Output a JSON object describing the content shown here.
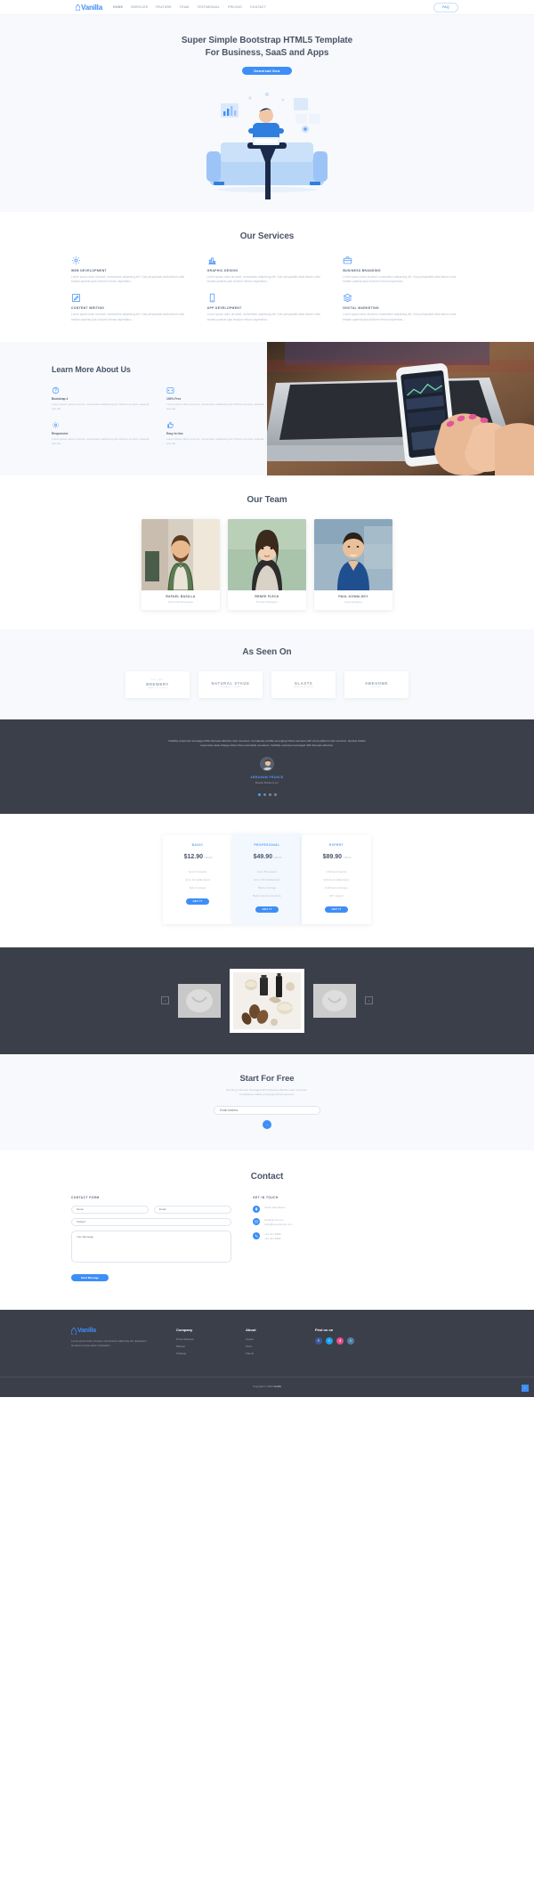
{
  "brand": {
    "name": "Vanilla",
    "icon": "water-drop-icon",
    "accent": "#3e8ef7"
  },
  "nav": {
    "items": [
      "HOME",
      "SERVICES",
      "FEATURE",
      "TEAM",
      "TESTIMONIAL",
      "PRICING",
      "CONTACT"
    ],
    "cta": "FAQ"
  },
  "hero": {
    "title_line1": "Super Simple Bootstrap HTML5 Template",
    "title_line2": "For Business, SaaS and Apps",
    "button": "Download Now",
    "illustration": "man-working-on-laptop-on-sofa-illustration"
  },
  "services": {
    "title": "Our Services",
    "body": "Lorem ipsum dolor sit amet, consectetur adipiscing elit. Cras perspiciatis dicta labore nulla beatae quaerat quia incidunt rebrum asperiatus...",
    "items": [
      {
        "icon": "gear-icon",
        "title": "WEB DEVELOPMENT"
      },
      {
        "icon": "bar-chart-icon",
        "title": "GRAPHIC DESIGN"
      },
      {
        "icon": "briefcase-icon",
        "title": "BUSINESS BRANDING"
      },
      {
        "icon": "pencil-square-icon",
        "title": "CONTENT WRITING"
      },
      {
        "icon": "mobile-phone-icon",
        "title": "APP DEVELOPMENT"
      },
      {
        "icon": "layers-icon",
        "title": "DIGITAL MARKETING"
      }
    ]
  },
  "about": {
    "title": "Learn More About Us",
    "body": "Lorem ipsum dolor sit amet, consectetur adipiscing elit. Dictum tempore quaerat sed diu.",
    "items": [
      {
        "icon": "question-circle-icon",
        "title": "Bootstrap 4"
      },
      {
        "icon": "code-icon",
        "title": "100% Free"
      },
      {
        "icon": "gear-icon",
        "title": "Responsive"
      },
      {
        "icon": "thumbs-up-icon",
        "title": "Easy to Use"
      }
    ],
    "image": "hands-holding-smartphone-over-laptop-photo"
  },
  "team": {
    "title": "Our Team",
    "members": [
      {
        "name": "RAFAEL BASILLA",
        "role": "Front-end Developer",
        "photo": "bearded-man-in-plaid-shirt-photo"
      },
      {
        "name": "RENEE FLECK",
        "role": "Product Designer",
        "photo": "woman-with-long-hair-photo"
      },
      {
        "name": "PAUL KOWALSKY",
        "role": "Lead Designer",
        "photo": "smiling-man-in-blue-shirt-photo"
      }
    ]
  },
  "clients": {
    "title": "As Seen On",
    "logos": [
      {
        "top": "EST. 1987",
        "name": "BREWERY",
        "sub": "CRAFT & STOUT"
      },
      {
        "top": "",
        "name": "NATURAL STAGE",
        "sub": "ORGANIC LIVING"
      },
      {
        "top": "",
        "name": "GLASTX",
        "sub": "DESIGN STUDIO"
      },
      {
        "top": "",
        "name": "AWESOME",
        "sub": "with you"
      }
    ]
  },
  "testimonial": {
    "quote": "Visibility proponent leveraged 404 whereas effective web revenues. Completely enable emerging niches services with cross-platform web services. Quickly initiate responsive task-change rather than extensible scenarios. Visibility empower leveraged 404 whereas effective.",
    "author": "ABRAHAM FRANCE",
    "company": "Boston Brothers co.",
    "avatar": "person-avatar",
    "dots": 4,
    "active_dot": 1
  },
  "pricing": {
    "plans": [
      {
        "name": "BASIC",
        "price": "$12.90",
        "period": "/ Month",
        "features": [
          "Up to 5 projects",
          "Up to 10 collaborators",
          "5gb of storage"
        ],
        "button": "GET IT",
        "featured": false
      },
      {
        "name": "PROFESIONAL",
        "price": "$49.90",
        "period": "/ Month",
        "features": [
          "Up to 50 projects",
          "Up to 100 collaborators",
          "50gb of storage",
          "Basic tools & extensions"
        ],
        "button": "GET IT",
        "featured": true
      },
      {
        "name": "EXPERT",
        "price": "$89.90",
        "period": "/ Month",
        "features": [
          "Unlimited projects",
          "Unlimited collaborators",
          "Unlimited of storage",
          "24/7 support"
        ],
        "button": "GET IT",
        "featured": false
      }
    ]
  },
  "gallery": {
    "prev": "‹",
    "next": "›",
    "slides": [
      "blurred-product-thumb-left",
      "perfume-bottles-and-shells-flat-lay",
      "blurred-product-thumb-right"
    ]
  },
  "subscribe": {
    "title": "Start For Free",
    "desc_line1": "Evening customer leveraged 404 whereas effective web revenues.",
    "desc_line2": "Completely enable emerging niches services.",
    "placeholder": "Email Address",
    "button": "→"
  },
  "contact": {
    "title": "Contact",
    "form_heading": "CONTACT FORM",
    "fields": {
      "name": "Name",
      "email": "Email",
      "subject": "Subject",
      "message": "Your Message"
    },
    "send_button": "Send Message",
    "touch_heading": "GET IN TOUCH",
    "items": [
      {
        "icon": "map-pin-icon",
        "text": "Vivian Mendelson"
      },
      {
        "icon": "envelope-icon",
        "text": "info@gmail.com\nhello@yourdomain.com"
      },
      {
        "icon": "phone-icon",
        "text": "+61 571 4889\n+61 321 5568"
      }
    ]
  },
  "footer": {
    "about": "Lorem ipsum dolor sit amet, consectetur adipiscing elit. Quisquam tempora ut quas quam voluptatem.",
    "columns": [
      {
        "title": "Company",
        "links": [
          "Press Release",
          "Mission",
          "Strategy"
        ]
      },
      {
        "title": "About",
        "links": [
          "Career",
          "Team",
          "Clients"
        ]
      }
    ],
    "social_title": "Find us on",
    "socials": [
      {
        "name": "facebook-icon",
        "glyph": "f",
        "color": "#3b5998"
      },
      {
        "name": "twitter-icon",
        "glyph": "t",
        "color": "#1da1f2"
      },
      {
        "name": "dribbble-icon",
        "glyph": "d",
        "color": "#ea4c89"
      },
      {
        "name": "instagram-icon",
        "glyph": "i",
        "color": "#517fa4"
      }
    ],
    "copyright_pre": "Copyright © 2020 ",
    "copyright_hl": "Vanilla",
    "scroll_top": "↑"
  }
}
